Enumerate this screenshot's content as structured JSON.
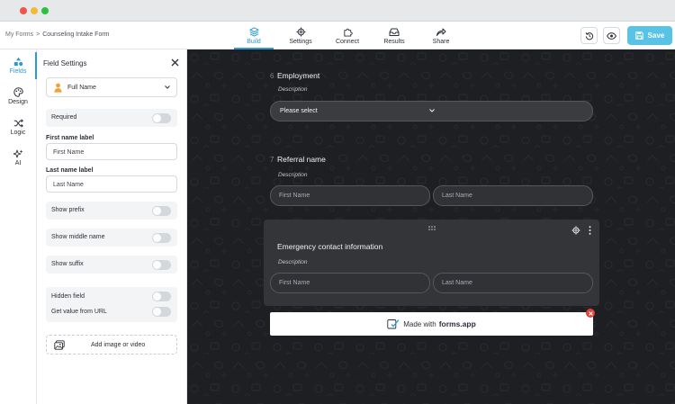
{
  "breadcrumb": {
    "root": "My Forms",
    "separator": ">",
    "current": "Counseling Intake Form"
  },
  "nav_tabs": [
    {
      "label": "Build",
      "icon": "build-stack-icon",
      "active": true
    },
    {
      "label": "Settings",
      "icon": "gear-icon",
      "active": false
    },
    {
      "label": "Connect",
      "icon": "puzzle-icon",
      "active": false
    },
    {
      "label": "Results",
      "icon": "inbox-icon",
      "active": false
    },
    {
      "label": "Share",
      "icon": "share-arrow-icon",
      "active": false
    }
  ],
  "toolbar": {
    "history_icon": "history-icon",
    "preview_icon": "eye-icon",
    "save_label": "Save"
  },
  "rail": [
    {
      "label": "Fields",
      "icon": "fields-shapes-icon",
      "active": true
    },
    {
      "label": "Design",
      "icon": "palette-icon",
      "active": false
    },
    {
      "label": "Logic",
      "icon": "shuffle-icon",
      "active": false
    },
    {
      "label": "AI",
      "icon": "sparkle-icon",
      "active": false
    }
  ],
  "field_settings": {
    "title": "Field Settings",
    "field_type": "Full Name",
    "required_label": "Required",
    "required_on": false,
    "first_name_label_title": "First name label",
    "first_name_label_value": "First Name",
    "last_name_label_title": "Last name label",
    "last_name_label_value": "Last Name",
    "show_prefix_label": "Show prefix",
    "show_prefix_on": false,
    "show_middle_label": "Show middle name",
    "show_middle_on": false,
    "show_suffix_label": "Show suffix",
    "show_suffix_on": false,
    "hidden_field_label": "Hidden field",
    "hidden_field_on": false,
    "url_value_label": "Get value from URL",
    "url_value_on": false,
    "add_media_label": "Add image or video"
  },
  "questions": [
    {
      "number": "6",
      "title": "Employment",
      "description": "Description",
      "select_value": "Please select"
    },
    {
      "number": "7",
      "title": "Referral name",
      "description": "Description",
      "first_placeholder": "First Name",
      "last_placeholder": "Last Name"
    },
    {
      "title": "Emergency contact information",
      "description": "Description",
      "first_placeholder": "First Name",
      "last_placeholder": "Last Name"
    }
  ],
  "branding": {
    "made_with": "Made with",
    "brand": "forms.app"
  },
  "colors": {
    "accent": "#2a9bd6",
    "save_button": "#58c3e6",
    "canvas_bg": "#1d1f22",
    "close_badge": "#e0443c"
  }
}
